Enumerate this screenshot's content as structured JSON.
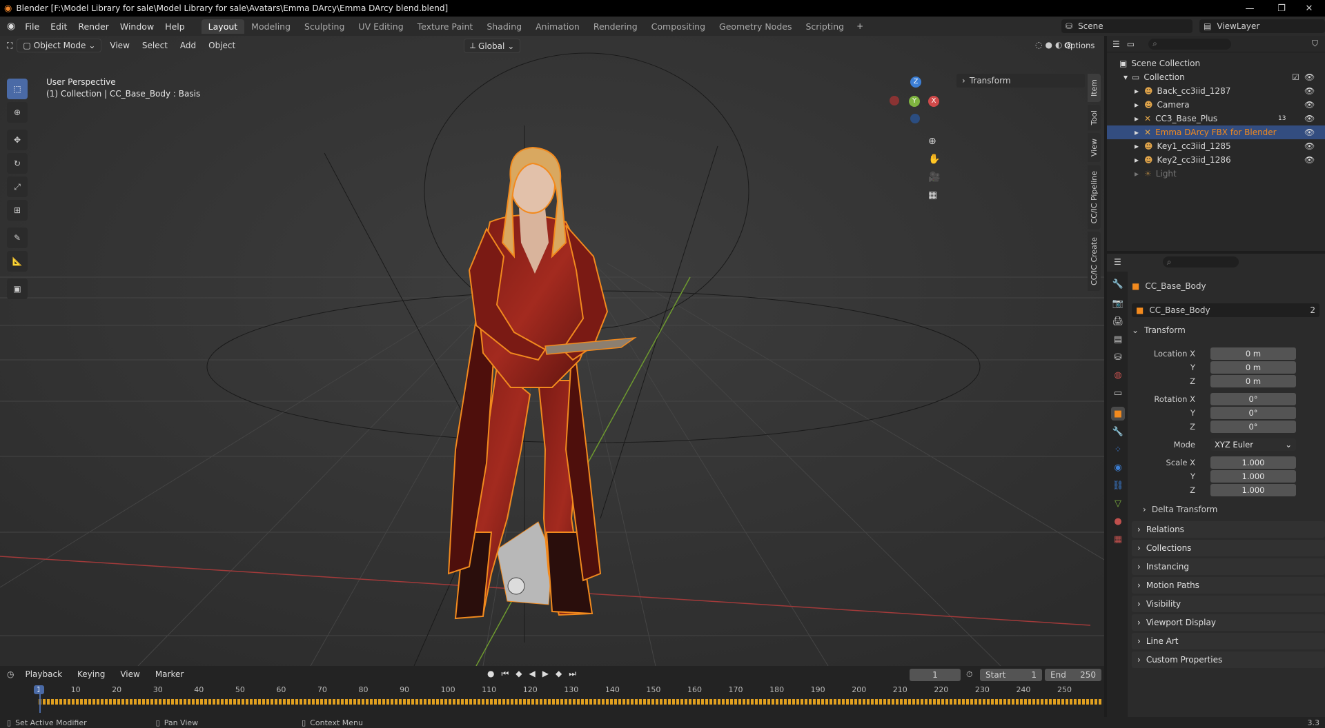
{
  "window": {
    "title": "Blender [F:\\Model Library for sale\\Model Library for sale\\Avatars\\Emma DArcy\\Emma DArcy blend.blend]"
  },
  "menu": [
    "File",
    "Edit",
    "Render",
    "Window",
    "Help"
  ],
  "workspaces": [
    "Layout",
    "Modeling",
    "Sculpting",
    "UV Editing",
    "Texture Paint",
    "Shading",
    "Animation",
    "Rendering",
    "Compositing",
    "Geometry Nodes",
    "Scripting"
  ],
  "active_workspace": "Layout",
  "scene": {
    "name": "Scene",
    "view_layer": "ViewLayer"
  },
  "viewport": {
    "mode": "Object Mode",
    "menus": [
      "View",
      "Select",
      "Add",
      "Object"
    ],
    "orientation": "Global",
    "options_label": "Options",
    "perspective_label": "User Perspective",
    "context_label": "(1) Collection | CC_Base_Body : Basis",
    "transform_panel": "Transform",
    "side_tabs": [
      "Item",
      "Tool",
      "View",
      "CC/IC Pipeline",
      "CC/IC Create"
    ],
    "gizmo": {
      "x": "X",
      "y": "Y",
      "z": "Z"
    }
  },
  "outliner": {
    "root": "Scene Collection",
    "collection": "Collection",
    "items": [
      {
        "name": "Back_cc3iid_1287",
        "selected": false
      },
      {
        "name": "Camera",
        "selected": false
      },
      {
        "name": "CC3_Base_Plus",
        "selected": false,
        "badge": "13"
      },
      {
        "name": "Emma DArcy FBX for Blender",
        "selected": true
      },
      {
        "name": "Key1_cc3iid_1285",
        "selected": false
      },
      {
        "name": "Key2_cc3iid_1286",
        "selected": false
      },
      {
        "name": "Light",
        "selected": false,
        "dimmed": true
      }
    ]
  },
  "properties": {
    "object_name": "CC_Base_Body",
    "data_name": "CC_Base_Body",
    "data_users": "2",
    "transform_header": "Transform",
    "location": {
      "label": "Location X",
      "x": "0 m",
      "y": "0 m",
      "z": "0 m"
    },
    "rotation": {
      "label": "Rotation X",
      "x": "0°",
      "y": "0°",
      "z": "0°"
    },
    "mode_label": "Mode",
    "mode_value": "XYZ Euler",
    "scale": {
      "label": "Scale X",
      "x": "1.000",
      "y": "1.000",
      "z": "1.000"
    },
    "axis_y": "Y",
    "axis_z": "Z",
    "delta_transform": "Delta Transform",
    "panels": [
      "Relations",
      "Collections",
      "Instancing",
      "Motion Paths",
      "Visibility",
      "Viewport Display",
      "Line Art",
      "Custom Properties"
    ]
  },
  "timeline": {
    "menus": [
      "Playback",
      "Keying",
      "View",
      "Marker"
    ],
    "current_frame": "1",
    "start_label": "Start",
    "start": "1",
    "end_label": "End",
    "end": "250",
    "ticks": [
      "1",
      "10",
      "20",
      "30",
      "40",
      "50",
      "60",
      "70",
      "80",
      "90",
      "100",
      "110",
      "120",
      "130",
      "140",
      "150",
      "160",
      "170",
      "180",
      "190",
      "200",
      "210",
      "220",
      "230",
      "240",
      "250"
    ]
  },
  "statusbar": {
    "left": "Set Active Modifier",
    "middle": "Pan View",
    "right": "Context Menu",
    "version": "3.3"
  },
  "colors": {
    "selection_orange": "#f28a1e",
    "active_blue": "#4a6aa6",
    "x_axis": "#d04a4a",
    "y_axis": "#7fb440",
    "z_axis": "#3c7fd6"
  }
}
